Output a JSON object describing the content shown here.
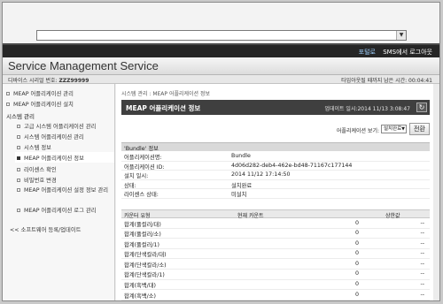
{
  "browser": {
    "address_value": ""
  },
  "topbar": {
    "link_portal": "포털로",
    "link_sms_logout": "SMS에서 로그아웃"
  },
  "app": {
    "title": "Service Management Service"
  },
  "infobar": {
    "device_label": "디바이스 시리얼 번호:",
    "device_serial": "ZZZ99999",
    "timeout_label": "타임아웃될 때까지 남은 시간: 00:04:41"
  },
  "sidebar": {
    "items": [
      {
        "label": "MEAP 어플리케이션 관리"
      },
      {
        "label": "MEAP 어플리케이션 설치"
      }
    ],
    "system_heading": "시스템 관리",
    "system_items": [
      {
        "label": "고급 시스템 어플리케이션 관리"
      },
      {
        "label": "시스템 어플리케이션 관리"
      },
      {
        "label": "시스템 정보"
      },
      {
        "label": "MEAP 어플리케이션 정보"
      },
      {
        "label": "라이센스 확인"
      },
      {
        "label": "비밀번호 변경"
      },
      {
        "label": "MEAP 어플리케이션 설정 정보 관리"
      },
      {
        "label": "MEAP 어플리케이션 로그 관리"
      }
    ],
    "back_link": "<< 소프트웨어 등록/업데이트"
  },
  "main": {
    "breadcrumb": "시스템 관리 : MEAP 어플리케이션 정보",
    "panel_title": "MEAP 어플리케이션 정보",
    "updated": "업데이트 일시:2014 11/13 3:08:47",
    "view_label": "어플리케이션 보기:",
    "view_select": "설치완료",
    "switch_button": "전환",
    "section_title": "'Bundle' 정보",
    "info": [
      {
        "key": "어플리케이션명:",
        "value": "Bundle"
      },
      {
        "key": "어플리케이션 ID:",
        "value": "4d06d282-deb4-462e-bd48-71167c177144"
      },
      {
        "key": "설치 일시:",
        "value": "2014 11/12 17:14:50"
      },
      {
        "key": "상태:",
        "value": "설치완료"
      },
      {
        "key": "라이센스 상태:",
        "value": "미설치"
      }
    ],
    "counter_headers": {
      "type": "카운터 유형",
      "current": "현재 카운트",
      "limit": "상한값"
    },
    "counters": [
      {
        "type": "합계(풀컬러/대)",
        "current": "0",
        "limit": "--"
      },
      {
        "type": "합계(풀컬러/소)",
        "current": "0",
        "limit": "--"
      },
      {
        "type": "합계(풀컬러/1)",
        "current": "0",
        "limit": "--"
      },
      {
        "type": "합계(단색칼라/대)",
        "current": "0",
        "limit": "--"
      },
      {
        "type": "합계(단색칼라/소)",
        "current": "0",
        "limit": "--"
      },
      {
        "type": "합계(단색칼라/1)",
        "current": "0",
        "limit": "--"
      },
      {
        "type": "합계(흑백/대)",
        "current": "0",
        "limit": "--"
      },
      {
        "type": "합계(흑백/소)",
        "current": "0",
        "limit": "--"
      }
    ]
  }
}
